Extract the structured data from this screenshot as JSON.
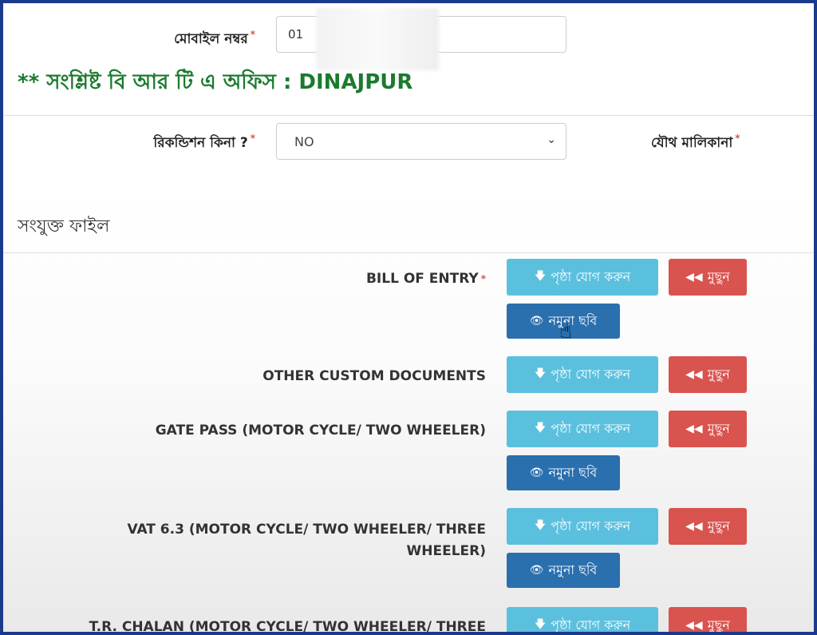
{
  "form": {
    "mobile_label": "মোবাইল নম্বর",
    "mobile_value": "01",
    "req_mark": "*",
    "notice": "** সংশ্লিষ্ট বি আর টি এ অফিস : DINAJPUR",
    "recondition_label": "রিকন্ডিশন কিনা ?",
    "recondition_value": "NO",
    "joint_label": "যৌথ মালিকানা"
  },
  "files": {
    "section_title": "সংযুক্ত ফাইল",
    "add_label": "পৃষ্ঠা যোগ করুন",
    "delete_label": "মুছুন",
    "sample_label": "নমুনা ছবি",
    "items": [
      {
        "label": "BILL OF ENTRY",
        "required": true
      },
      {
        "label": "OTHER CUSTOM DOCUMENTS"
      },
      {
        "label": "GATE PASS (MOTOR CYCLE/ TWO WHEELER)"
      },
      {
        "label_line1": "VAT 6.3 (MOTOR CYCLE/ TWO WHEELER/ THREE",
        "label_line2": "WHEELER)"
      },
      {
        "label": "T.R. CHALAN (MOTOR CYCLE/ TWO WHEELER/ THREE"
      }
    ]
  },
  "icons": {
    "down": "🡇",
    "rewind": "◀◀",
    "eye": "👁",
    "chevron": "⌄",
    "hand": "☝"
  }
}
